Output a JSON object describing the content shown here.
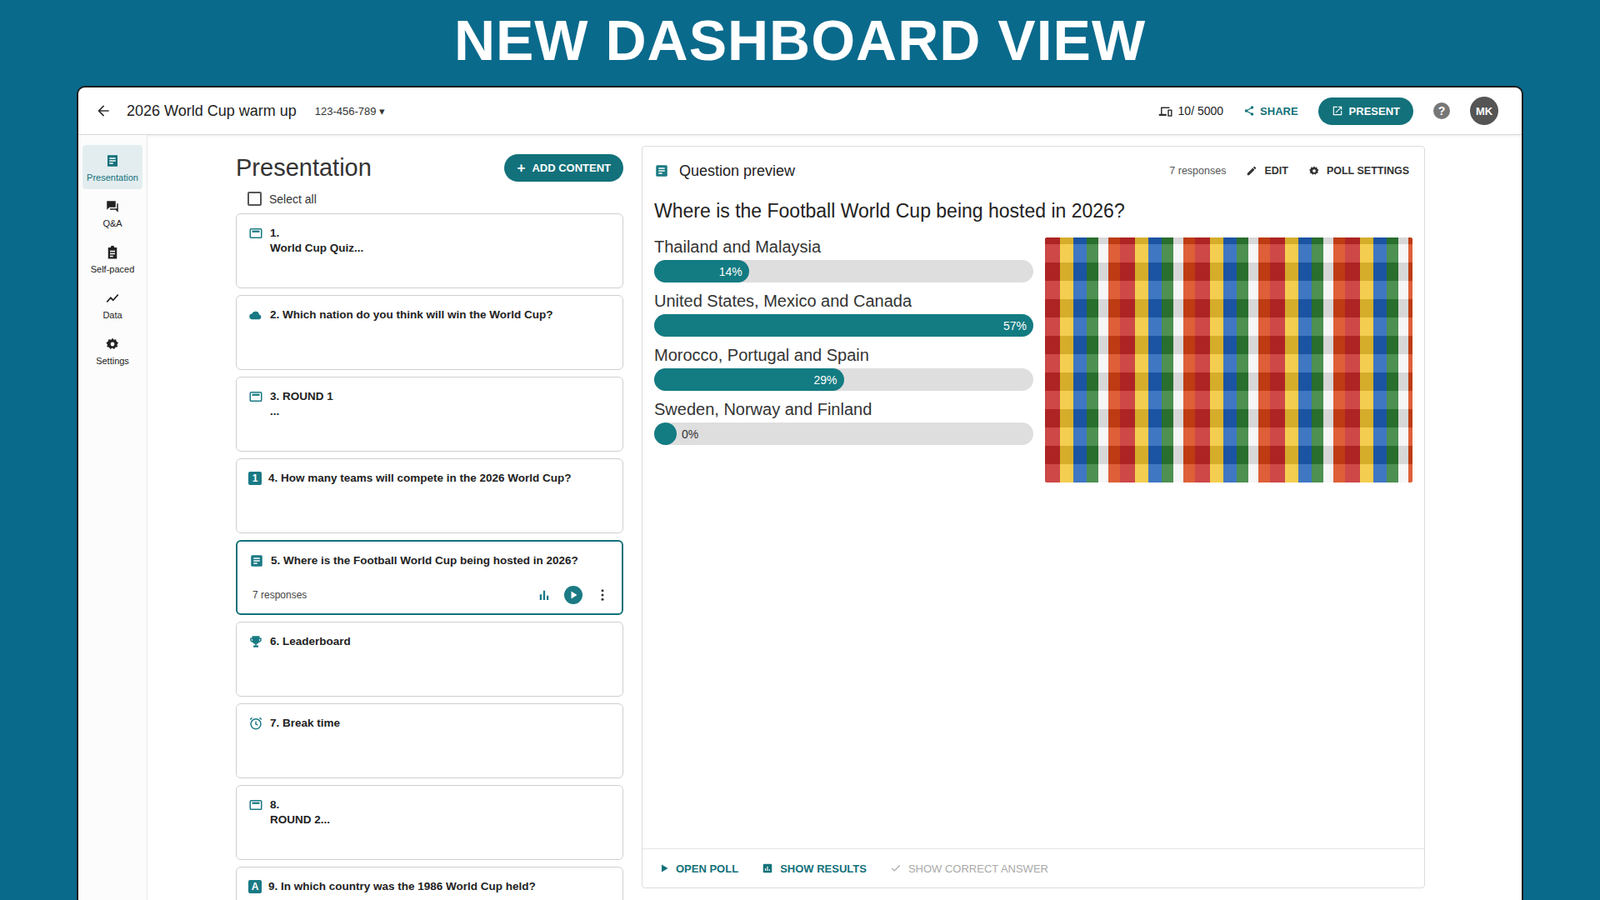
{
  "banner": "NEW DASHBOARD VIEW",
  "topbar": {
    "title": "2026 World Cup warm up",
    "code": "123-456-789",
    "code_caret": "▾",
    "participants": "10/ 5000",
    "share": "SHARE",
    "present": "PRESENT",
    "help": "?",
    "avatar": "MK"
  },
  "rail": [
    {
      "label": "Presentation",
      "selected": true
    },
    {
      "label": "Q&A",
      "selected": false
    },
    {
      "label": "Self-paced",
      "selected": false
    },
    {
      "label": "Data",
      "selected": false
    },
    {
      "label": "Settings",
      "selected": false
    }
  ],
  "list": {
    "title": "Presentation",
    "add_icon": "+",
    "add_label": "ADD CONTENT",
    "select_all": {
      "label": "Select all",
      "checked": false
    },
    "slides": [
      {
        "kind": "slide",
        "lines": [
          "1.",
          "World Cup Quiz..."
        ],
        "selected": false
      },
      {
        "kind": "cloud",
        "lines": [
          "2. Which nation do you think will win the World Cup?"
        ],
        "selected": false
      },
      {
        "kind": "slide",
        "lines": [
          "3. ROUND 1",
          "..."
        ],
        "selected": false
      },
      {
        "kind": "boxed",
        "icon_text": "1",
        "lines": [
          "4. How many teams will compete in the 2026 World Cup?"
        ],
        "selected": false
      },
      {
        "kind": "poll",
        "lines": [
          "5. Where is the Football World Cup being hosted in 2026?"
        ],
        "selected": true,
        "responses": "7 responses"
      },
      {
        "kind": "trophy",
        "lines": [
          "6. Leaderboard"
        ],
        "selected": false
      },
      {
        "kind": "clock",
        "lines": [
          "7. Break time"
        ],
        "selected": false
      },
      {
        "kind": "slide",
        "lines": [
          "8.",
          "ROUND 2..."
        ],
        "selected": false
      },
      {
        "kind": "boxed",
        "icon_text": "A",
        "lines": [
          "9. In which country was the 1986 World Cup held?"
        ],
        "selected": false
      }
    ]
  },
  "preview": {
    "header": "Question preview",
    "responses": "7 responses",
    "edit": "EDIT",
    "settings": "POLL SETTINGS",
    "question": "Where is the Football World Cup being hosted in 2026?",
    "options": [
      {
        "label": "Thailand and Malaysia",
        "reading": "14%",
        "level": 0.25
      },
      {
        "label": "United States, Mexico and Canada",
        "reading": "57%",
        "level": 1.0
      },
      {
        "label": "Morocco, Portugal and Spain",
        "reading": "29%",
        "level": 0.5
      },
      {
        "label": "Sweden, Norway and Finland",
        "reading": "0%",
        "level": 0.0
      }
    ],
    "footer": [
      {
        "kind": "open",
        "label": "OPEN POLL",
        "disabled": false
      },
      {
        "kind": "results",
        "label": "SHOW RESULTS",
        "disabled": false
      },
      {
        "kind": "answer",
        "label": "SHOW CORRECT ANSWER",
        "disabled": true
      }
    ]
  }
}
